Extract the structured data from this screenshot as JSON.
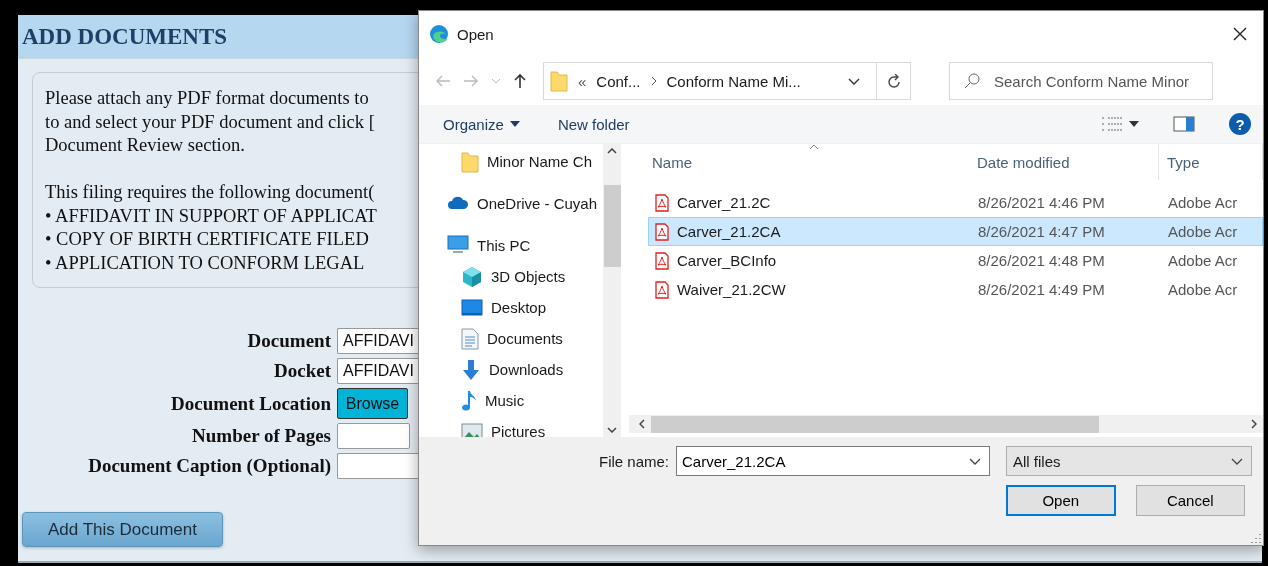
{
  "page": {
    "title": "ADD DOCUMENTS",
    "instructions": [
      "Please attach any PDF format documents to",
      "to and select your PDF document and click [",
      "Document Review section."
    ],
    "requirements_intro": "This filing requires the following document(",
    "requirements": [
      "• AFFIDAVIT IN SUPPORT OF APPLICAT",
      "• COPY OF BIRTH CERTIFICATE FILED",
      "• APPLICATION TO CONFORM LEGAL"
    ],
    "form": [
      {
        "kind": "text",
        "label": "Document",
        "value": "AFFIDAVI"
      },
      {
        "kind": "text",
        "label": "Docket",
        "value": "AFFIDAVI"
      },
      {
        "kind": "button",
        "label": "Document Location",
        "button": "Browse"
      },
      {
        "kind": "short-text",
        "label": "Number of Pages"
      },
      {
        "kind": "text",
        "label": "Document Caption (Optional)"
      }
    ],
    "add_button": "Add This Document"
  },
  "dialog": {
    "title": "Open",
    "breadcrumb": {
      "overflow": "«",
      "parts": [
        "Conf...",
        "Conform Name Mi..."
      ]
    },
    "search": {
      "placeholder": "Search Conform Name Minor"
    },
    "toolbar": {
      "organize": "Organize",
      "new_folder": "New folder",
      "help": "?"
    },
    "nav_pane": {
      "scrolled_children": [
        {
          "kind": "folder",
          "label": "Minor Name Ch"
        }
      ],
      "items": [
        {
          "kind": "cloud",
          "label": "OneDrive - Cuyah"
        },
        {
          "kind": "pc",
          "label": "This PC",
          "children": [
            {
              "kind": "cube",
              "label": "3D Objects"
            },
            {
              "kind": "desktop",
              "label": "Desktop"
            },
            {
              "kind": "documents",
              "label": "Documents"
            },
            {
              "kind": "downloads",
              "label": "Downloads"
            },
            {
              "kind": "music",
              "label": "Music"
            },
            {
              "kind": "pictures",
              "label": "Pictures"
            }
          ]
        }
      ]
    },
    "columns": [
      "Name",
      "Date modified",
      "Type"
    ],
    "files": [
      {
        "name": "Carver_21.2C",
        "date": "8/26/2021 4:46 PM",
        "type": "Adobe Acr",
        "selected": false
      },
      {
        "name": "Carver_21.2CA",
        "date": "8/26/2021 4:47 PM",
        "type": "Adobe Acr",
        "selected": true
      },
      {
        "name": "Carver_BCInfo",
        "date": "8/26/2021 4:48 PM",
        "type": "Adobe Acr",
        "selected": false
      },
      {
        "name": "Waiver_21.2CW",
        "date": "8/26/2021 4:49 PM",
        "type": "Adobe Acr",
        "selected": false
      }
    ],
    "file_name_label": "File name:",
    "file_name": "Carver_21.2CA",
    "file_type": "All files",
    "buttons": [
      {
        "label": "Open",
        "default": true
      },
      {
        "label": "Cancel",
        "default": false
      }
    ]
  }
}
